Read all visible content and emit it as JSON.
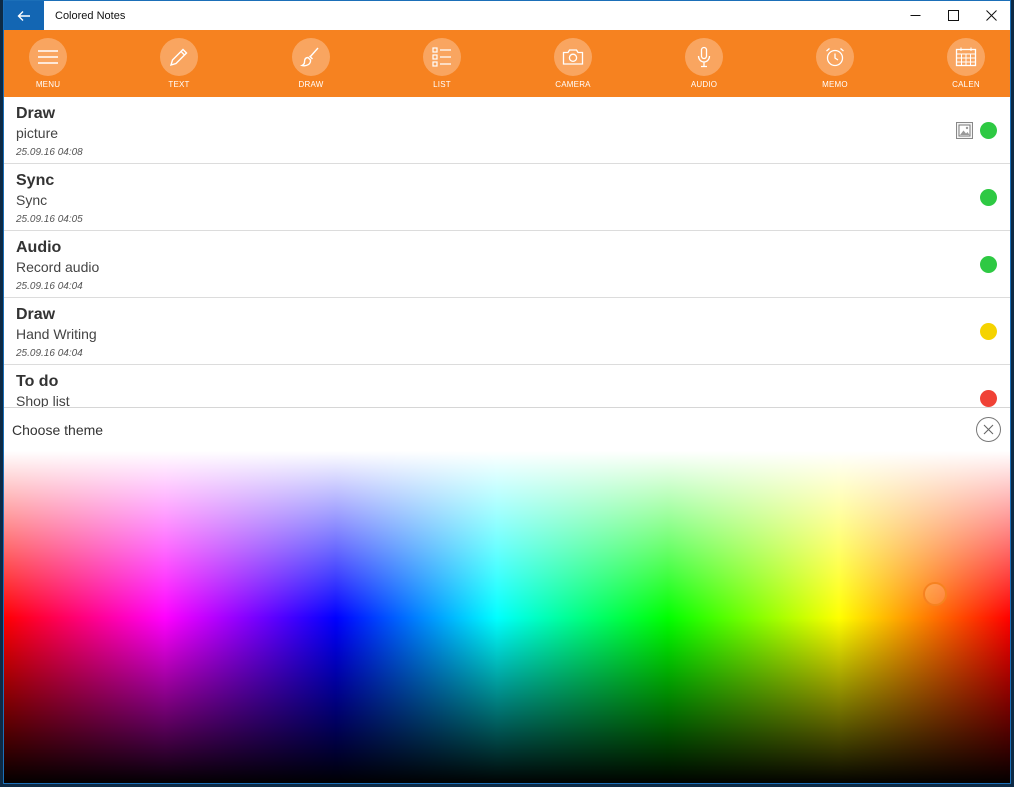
{
  "window": {
    "title": "Colored Notes"
  },
  "toolbar": {
    "items": [
      {
        "label": "MENU"
      },
      {
        "label": "TEXT"
      },
      {
        "label": "DRAW"
      },
      {
        "label": "LIST"
      },
      {
        "label": "CAMERA"
      },
      {
        "label": "AUDIO"
      },
      {
        "label": "MEMO"
      },
      {
        "label": "CALEN"
      }
    ]
  },
  "notes": [
    {
      "title": "Draw",
      "subtitle": "picture",
      "date": "25.09.16 04:08",
      "color": "#2ec943",
      "has_image": true
    },
    {
      "title": "Sync",
      "subtitle": "Sync",
      "date": "25.09.16 04:05",
      "color": "#2ec943",
      "has_image": false
    },
    {
      "title": "Audio",
      "subtitle": "Record audio",
      "date": "25.09.16 04:04",
      "color": "#2ec943",
      "has_image": false
    },
    {
      "title": "Draw",
      "subtitle": "Hand Writing",
      "date": "25.09.16 04:04",
      "color": "#f5d300",
      "has_image": false
    },
    {
      "title": "To do",
      "subtitle": "Shop list",
      "date": "",
      "color": "#f04236",
      "has_image": false
    }
  ],
  "theme": {
    "label": "Choose theme"
  },
  "colors": {
    "accent": "#f68220",
    "titlebar_back": "#1366b3"
  }
}
